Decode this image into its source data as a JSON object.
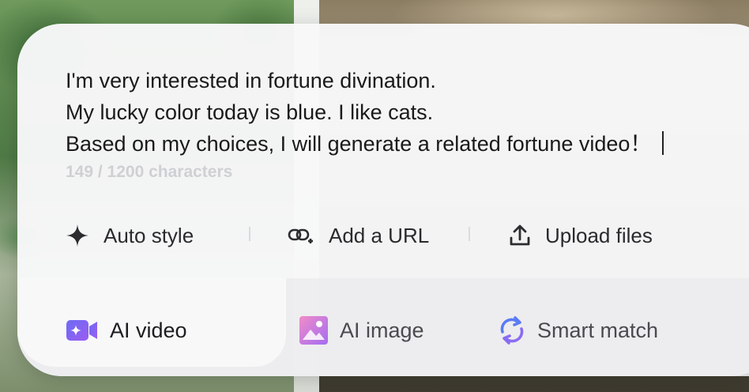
{
  "prompt": {
    "lines": [
      "I'm very interested in fortune divination.",
      "My lucky color today is blue. I like cats.",
      "Based on my choices, I will generate a related fortune video！"
    ],
    "counter": "149 / 1200 characters"
  },
  "actions": {
    "auto_style": {
      "label": "Auto style",
      "icon": "sparkle-icon"
    },
    "add_url": {
      "label": "Add a URL",
      "icon": "link-plus-icon"
    },
    "upload_files": {
      "label": "Upload files",
      "icon": "upload-icon"
    }
  },
  "tabs": {
    "ai_video": {
      "label": "AI video",
      "icon": "video-camera-icon",
      "active": true
    },
    "ai_image": {
      "label": "AI image",
      "icon": "image-icon",
      "active": false
    },
    "smart_match": {
      "label": "Smart match",
      "icon": "refresh-icon",
      "active": false
    }
  },
  "colors": {
    "accent_purple": "#7a5cf0",
    "accent_blue": "#5b7cf5",
    "image_pink": "#e27ed0",
    "text_primary": "#1a1a1a",
    "text_muted": "#cfd0d4"
  }
}
